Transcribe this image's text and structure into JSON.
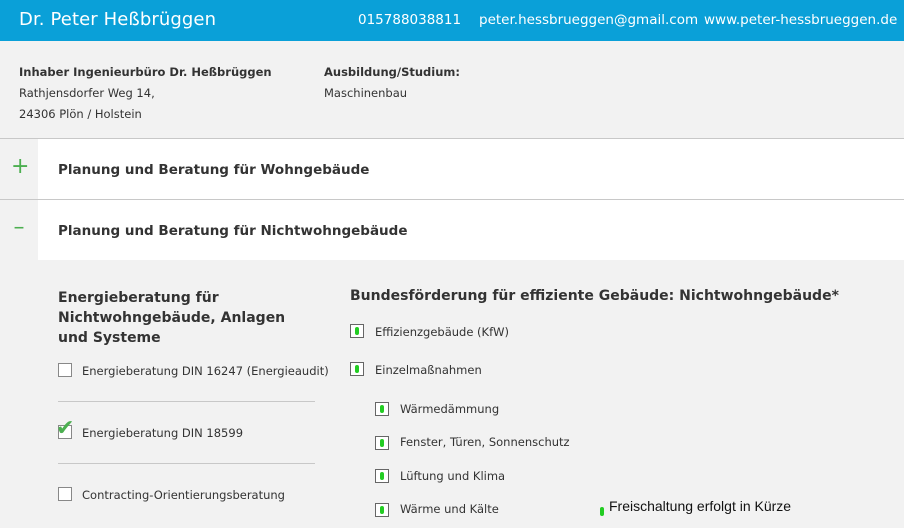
{
  "header": {
    "name": "Dr. Peter Heßbrüggen",
    "phone": "015788038811",
    "email": "peter.hessbrueggen@gmail.com",
    "website": "www.peter-hessbrueggen.de"
  },
  "info": {
    "owner_title": "Inhaber Ingenieurbüro Dr. Heßbrüggen",
    "street": "Rathjensdorfer Weg 14,",
    "city": "24306 Plön / Holstein",
    "education_label": "Ausbildung/Studium:",
    "education_value": "Maschinenbau"
  },
  "accordion": [
    {
      "toggle": "+",
      "title": "Planung und Beratung für Wohngebäude",
      "expanded": false
    },
    {
      "toggle": "–",
      "title": "Planung und Beratung für Nichtwohngebäude",
      "expanded": true
    }
  ],
  "left_section": {
    "heading": "Energieberatung für Nichtwohngebäude, Anlagen und Systeme",
    "items": [
      {
        "label": "Energieberatung DIN 16247 (Energieaudit)",
        "checked": false
      },
      {
        "label": "Energieberatung DIN 18599",
        "checked": true
      },
      {
        "label": "Contracting-Orientierungsberatung",
        "checked": false
      }
    ]
  },
  "right_section": {
    "heading": "Bundesförderung für effiziente Gebäude: Nichtwohngebäude*",
    "items": [
      {
        "label": "Effizienzgebäude (KfW)",
        "level": 0
      },
      {
        "label": "Einzelmaßnahmen",
        "level": 0
      },
      {
        "label": "Wärmedämmung",
        "level": 1
      },
      {
        "label": "Fenster, Türen, Sonnenschutz",
        "level": 1
      },
      {
        "label": "Lüftung und Klima",
        "level": 1
      },
      {
        "label": "Wärme und Kälte",
        "level": 1
      }
    ]
  },
  "notice": "Freischaltung erfolgt in Kürze",
  "colors": {
    "header_bg": "#0aa0d8",
    "accent_green": "#4caf50",
    "indicator_green": "#22cc22",
    "panel_bg": "#f2f2f2"
  }
}
